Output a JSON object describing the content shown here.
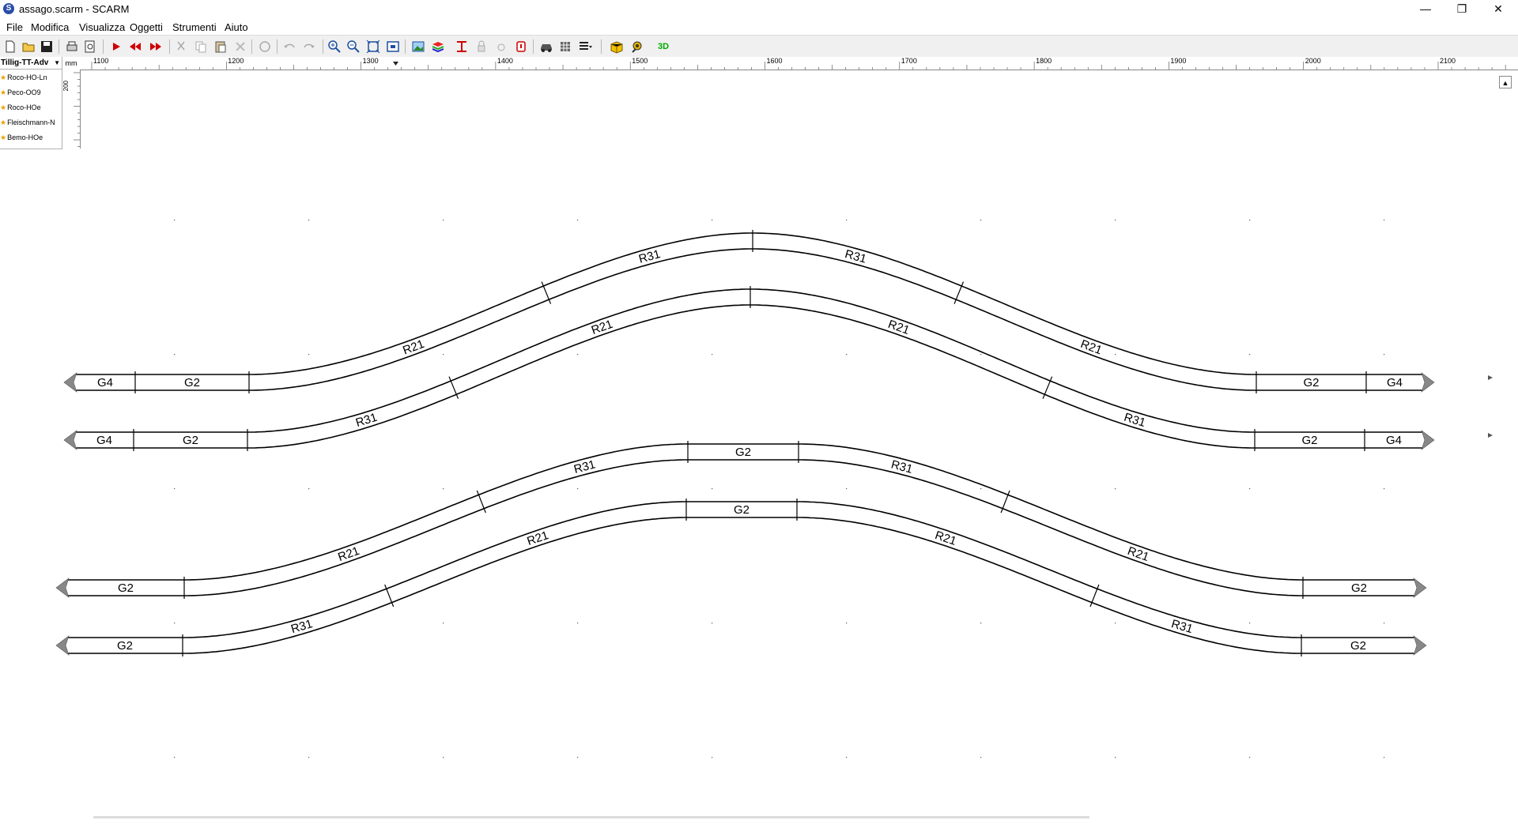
{
  "window": {
    "title": "assago.scarm - SCARM",
    "app_icon": "S",
    "minimize": "—",
    "maximize": "❐",
    "close": "✕"
  },
  "menu": [
    "File",
    "Modifica",
    "Visualizza",
    "Oggetti",
    "Strumenti",
    "Aiuto"
  ],
  "toolbar": {
    "buttons": [
      "new-file-icon",
      "open-folder-icon",
      "save-icon",
      "print-icon",
      "print-preview-icon",
      "run-icon",
      "rewind-icon",
      "fast-forward-icon",
      "cut-icon",
      "copy-icon",
      "paste-icon",
      "delete-icon",
      "rotate-icon",
      "undo-icon",
      "redo-icon",
      "zoom-in-icon",
      "zoom-out-icon",
      "zoom-fit-icon",
      "zoom-window-icon",
      "image-icon",
      "layers-icon",
      "height-icon",
      "lock-icon",
      "group-icon",
      "alert-icon",
      "car-icon",
      "grid-icon",
      "list-dropdown-icon",
      "package-icon",
      "measure-icon",
      "view-3d-icon"
    ],
    "view3d_label": "3D"
  },
  "library": {
    "selected": "Tillig-TT-Adv",
    "favorites": [
      "Roco-HO-Ln",
      "Peco-OO9",
      "Roco-HOe",
      "Fleischmann-N",
      "Bemo-HOe"
    ]
  },
  "ruler": {
    "unit": "mm",
    "x_labels": [
      "1100",
      "1200",
      "1300",
      "1400",
      "1500",
      "1600",
      "1700",
      "1800",
      "1900",
      "2000",
      "2100"
    ],
    "y_labels": [
      "200"
    ]
  },
  "layout": {
    "groups": [
      {
        "labels": [
          "G4",
          "G2",
          "R21",
          "R31",
          "R31",
          "R21",
          "G2",
          "G4"
        ]
      },
      {
        "labels": [
          "G4",
          "G2",
          "R31",
          "R21",
          "R21",
          "R31",
          "G2",
          "G4"
        ]
      },
      {
        "labels": [
          "G2",
          "R21",
          "R31",
          "G2",
          "R31",
          "R21",
          "G2"
        ]
      },
      {
        "labels": [
          "G2",
          "R31",
          "R21",
          "G2",
          "R21",
          "R31",
          "G2"
        ]
      }
    ]
  },
  "colors": {
    "track": "#000000",
    "background": "#ffffff",
    "toolbar": "#f0f0f0",
    "accent": "#e8a200"
  }
}
